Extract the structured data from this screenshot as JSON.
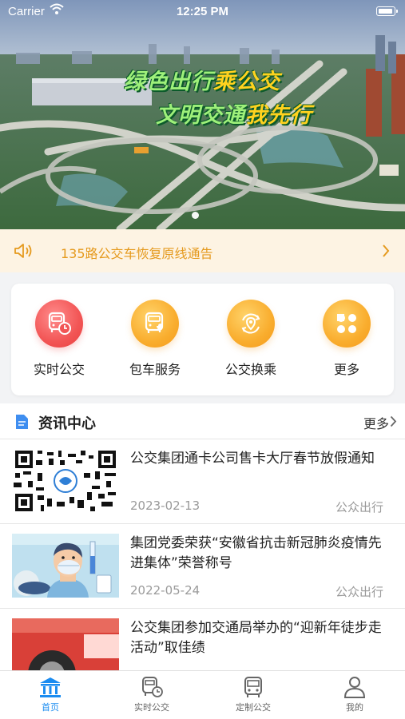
{
  "status_bar": {
    "carrier": "Carrier",
    "time": "12:25 PM"
  },
  "banner": {
    "slogan_line1_green": "绿色出行",
    "slogan_line1_yellow": "乘公交",
    "slogan_line2_green": "文明交通",
    "slogan_line2_yellow": "我先行",
    "slide_count": 1,
    "active_slide": 1
  },
  "notice": {
    "text": "135路公交车恢复原线通告"
  },
  "services": [
    {
      "label": "实时公交",
      "icon": "bus-clock-icon",
      "color": "#f25555"
    },
    {
      "label": "包车服务",
      "icon": "bus-heart-icon",
      "color": "#f9ad2e"
    },
    {
      "label": "公交换乘",
      "icon": "transfer-location-icon",
      "color": "#f9ad2e"
    },
    {
      "label": "更多",
      "icon": "grid-more-icon",
      "color": "#f9ad2e"
    }
  ],
  "news_section": {
    "title": "资讯中心",
    "more_label": "更多"
  },
  "news": [
    {
      "headline": "公交集团通卡公司售卡大厅春节放假通知",
      "date": "2023-02-13",
      "source": "公众出行",
      "thumb": "qr-code"
    },
    {
      "headline": "集团党委荣获“安徽省抗击新冠肺炎疫情先进集体”荣誉称号",
      "date": "2022-05-24",
      "source": "公众出行",
      "thumb": "doctor-illustration"
    },
    {
      "headline": "公交集团参加交通局举办的“迎新年徒步走活动”取佳绩",
      "date": "",
      "source": "",
      "thumb": "bus-photo"
    }
  ],
  "tabbar": [
    {
      "label": "首页",
      "icon": "home-icon",
      "active": true
    },
    {
      "label": "实时公交",
      "icon": "bus-clock-icon",
      "active": false
    },
    {
      "label": "定制公交",
      "icon": "bus-icon",
      "active": false
    },
    {
      "label": "我的",
      "icon": "user-icon",
      "active": false
    }
  ],
  "colors": {
    "accent_blue": "#1b8cf0",
    "notice_orange": "#e59a1e",
    "notice_bg": "#fdf3e3"
  }
}
